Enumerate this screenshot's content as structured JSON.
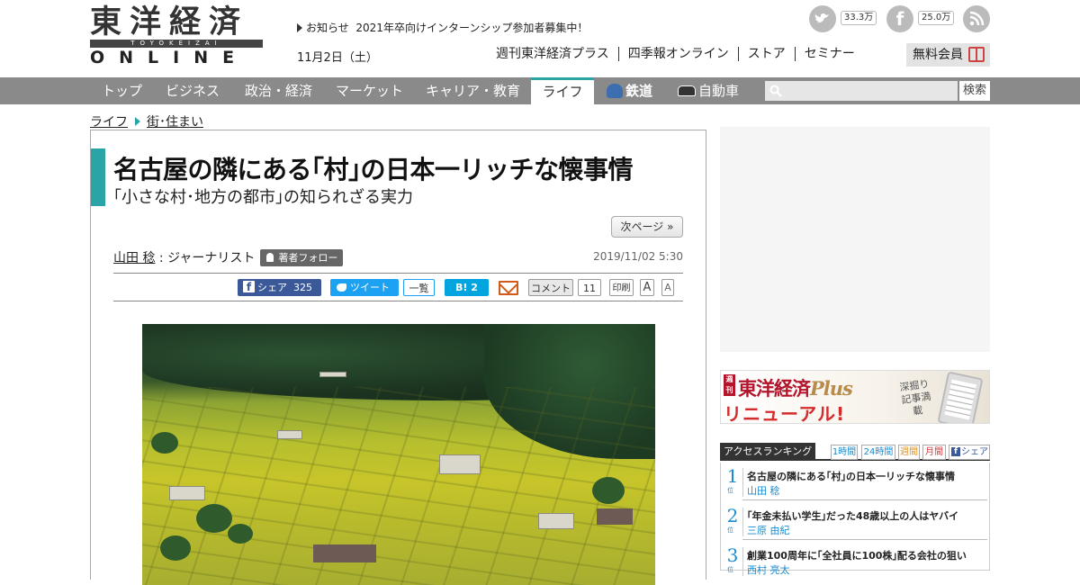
{
  "logo": {
    "main": "東洋経済",
    "band": "TOYOKEIZAI",
    "sub": "ONLINE"
  },
  "header": {
    "notice_prefix": "お知らせ",
    "notice_text": "2021年卒向けインターンシップ参加者募集中！",
    "date": "11月2日（土）",
    "twitter_count": "33.3万",
    "facebook_count": "25.0万",
    "top_links": [
      "週刊東洋経済プラス",
      "四季報オンライン",
      "ストア",
      "セミナー"
    ],
    "member_label": "無料会員"
  },
  "nav": {
    "items": [
      "トップ",
      "ビジネス",
      "政治・経済",
      "マーケット",
      "キャリア・教育",
      "ライフ",
      "鉄道",
      "自動車"
    ],
    "active": "ライフ",
    "search_placeholder": "",
    "search_button": "検索"
  },
  "breadcrumb": {
    "level1": "ライフ",
    "level2": "街･住まい"
  },
  "article": {
    "title": "名古屋の隣にある｢村｣の日本一リッチな懐事情",
    "subtitle": "｢小さな村･地方の都市｣の知られざる実力",
    "next_page": "次ページ »",
    "author_name": "山田 稔",
    "author_role": " : ジャーナリスト",
    "follow_label": "著者フォロー",
    "published": "2019/11/02 5:30",
    "share": {
      "facebook": "シェア",
      "facebook_count": "325",
      "tweet": "ツイート",
      "list": "一覧",
      "hatena": "B! 2",
      "comment": "コメント",
      "comment_count": "11",
      "print": "印刷",
      "font_large": "A",
      "font_small": "A"
    }
  },
  "sidebar": {
    "banner": {
      "badge": "週刊",
      "title": "東洋経済",
      "plus": "Plus",
      "renewal": "リニューアル!",
      "copy": "深掘り記事満載"
    },
    "ranking": {
      "label": "アクセスランキング",
      "tabs": [
        "1時間",
        "24時間",
        "週間",
        "月間",
        "シェア"
      ],
      "position_suffix": "位",
      "items": [
        {
          "rank": "1",
          "title": "名古屋の隣にある｢村｣の日本一リッチな懐事情",
          "author": "山田 稔"
        },
        {
          "rank": "2",
          "title": "｢年金未払い学生｣だった48歳以上の人はヤバイ",
          "author": "三原 由紀"
        },
        {
          "rank": "3",
          "title": "創業100周年に｢全社員に100株｣配る会社の狙い",
          "author": "西村 亮太"
        }
      ]
    }
  },
  "colors": {
    "accent": "#2aa4a6",
    "nav_bg": "#8a8a8a",
    "ranking_blue": "#1a8bd0",
    "facebook": "#3b5998",
    "twitter": "#1da1f2"
  }
}
